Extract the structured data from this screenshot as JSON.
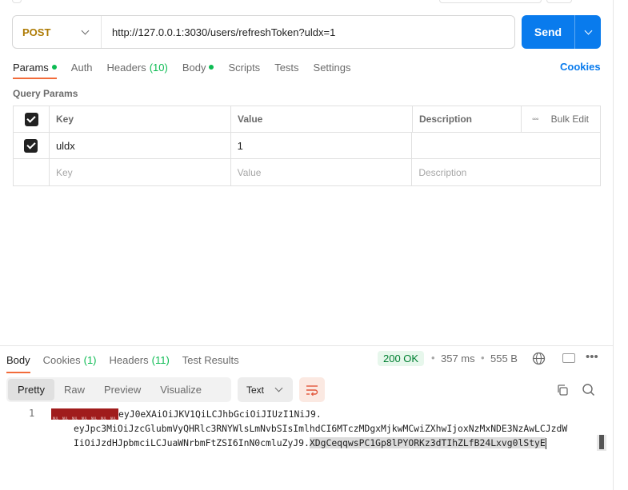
{
  "request": {
    "method": "POST",
    "url": "http://127.0.0.1:3030/users/refreshToken?uldx=1",
    "send_label": "Send"
  },
  "tabs": [
    {
      "label": "Params",
      "dot": true,
      "active": true
    },
    {
      "label": "Auth"
    },
    {
      "label": "Headers",
      "count": "(10)"
    },
    {
      "label": "Body",
      "dot": true
    },
    {
      "label": "Scripts"
    },
    {
      "label": "Tests"
    },
    {
      "label": "Settings"
    }
  ],
  "cookies_label": "Cookies",
  "query_params": {
    "title": "Query Params",
    "headers": {
      "key": "Key",
      "value": "Value",
      "description": "Description",
      "bulk_edit": "Bulk Edit"
    },
    "rows": [
      {
        "checked": true,
        "key": "uldx",
        "value": "1",
        "description": ""
      }
    ],
    "placeholders": {
      "key": "Key",
      "value": "Value",
      "description": "Description"
    }
  },
  "response": {
    "tabs": [
      {
        "label": "Body",
        "active": true
      },
      {
        "label": "Cookies",
        "count": "(1)"
      },
      {
        "label": "Headers",
        "count": "(11)"
      },
      {
        "label": "Test Results"
      }
    ],
    "status": "200 OK",
    "time": "357 ms",
    "size": "555 B",
    "views": [
      "Pretty",
      "Raw",
      "Preview",
      "Visualize"
    ],
    "active_view": "Pretty",
    "format": "Text",
    "line_number": "1",
    "body_lines": [
      "eyJ0eXAiOiJKV1QiLCJhbGciOiJIUzI1NiJ9.",
      "eyJpc3MiOiJzcGlubmVyQHRlc3RNYWlsLmNvbSIsImlhdCI6MTczMDgxMjkwMCwiZXhwIjoxNzMxNDE3NzAwLCJzdW",
      "IiOiJzdHJpbmciLCJuaWNrbmFtZSI6InN0cmluZyJ9."
    ],
    "body_selected": "XDgCeqqwsPC1Gp8lPYORKz3dTIhZLfB24Lxvg0lStyE",
    "nul_marker": "NUL"
  }
}
